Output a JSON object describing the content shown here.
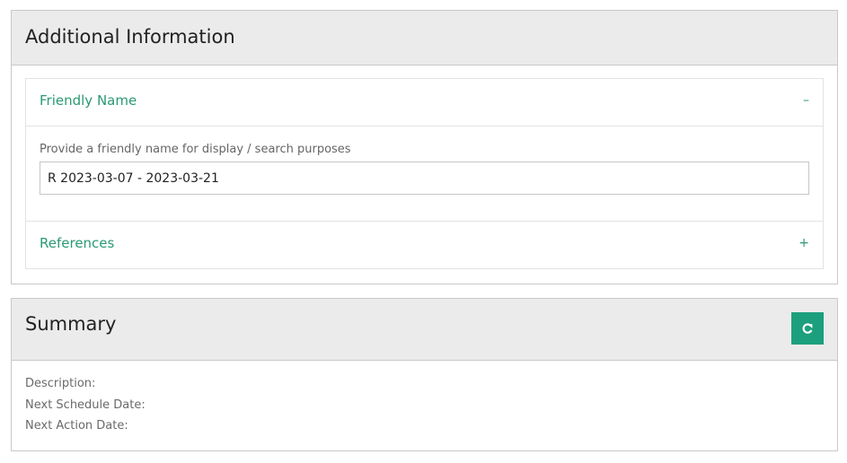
{
  "additional_info": {
    "title": "Additional Information",
    "friendly_name_section": {
      "title": "Friendly Name",
      "toggle": "–",
      "field_label": "Provide a friendly name for display / search purposes",
      "field_value": "R 2023-03-07 - 2023-03-21"
    },
    "references_section": {
      "title": "References",
      "toggle": "+"
    }
  },
  "summary": {
    "title": "Summary",
    "refresh_icon": "refresh-icon",
    "accent_color": "#1c9f7d",
    "rows": [
      "Description:",
      "Next Schedule Date:",
      "Next Action Date:"
    ]
  }
}
